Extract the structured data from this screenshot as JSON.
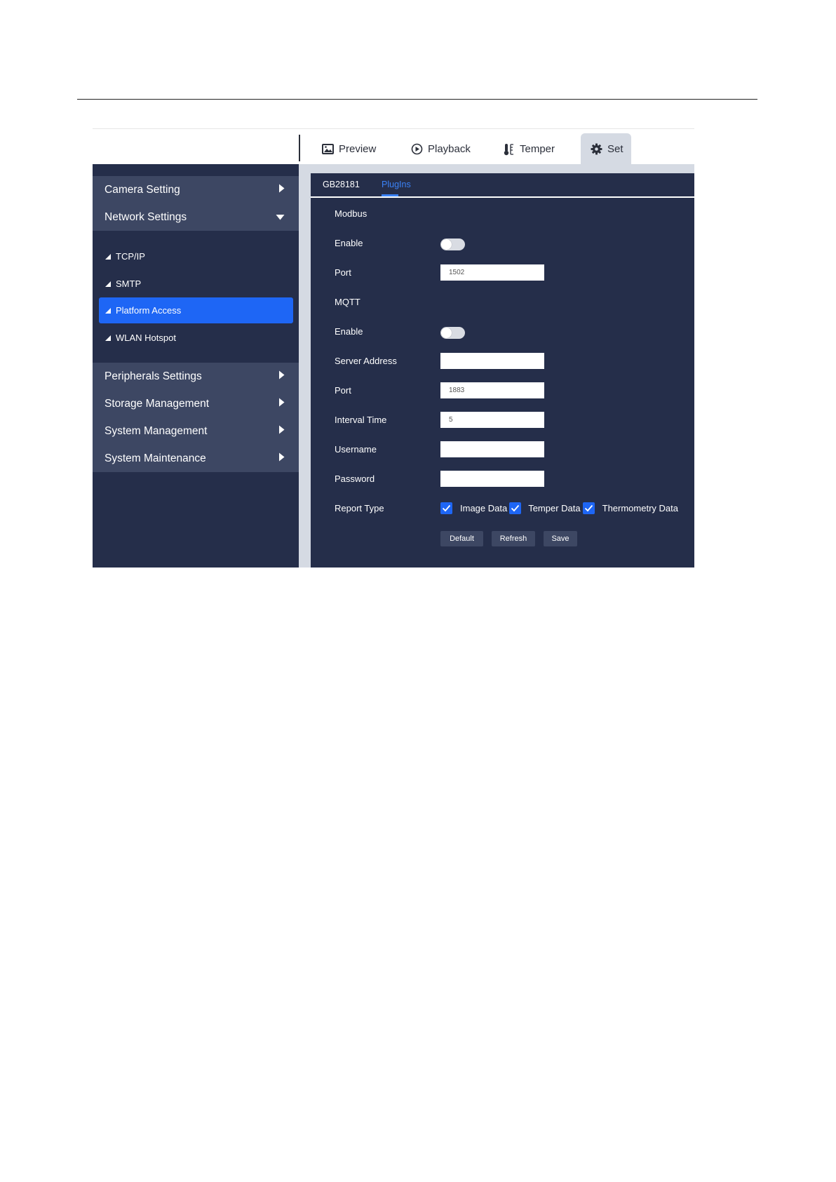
{
  "topnav": {
    "tabs": [
      {
        "label": "Preview",
        "icon": "image-icon"
      },
      {
        "label": "Playback",
        "icon": "play-circle-icon"
      },
      {
        "label": "Temper",
        "icon": "thermometer-icon"
      },
      {
        "label": "Set",
        "icon": "gear-icon",
        "active": true
      }
    ]
  },
  "sidebar": {
    "sections": [
      {
        "label": "Camera Setting",
        "expanded": false
      },
      {
        "label": "Network Settings",
        "expanded": true
      },
      {
        "label": "Peripherals Settings",
        "expanded": false
      },
      {
        "label": "Storage Management",
        "expanded": false
      },
      {
        "label": "System Management",
        "expanded": false
      },
      {
        "label": "System Maintenance",
        "expanded": false
      }
    ],
    "network_items": [
      {
        "label": "TCP/IP"
      },
      {
        "label": "SMTP"
      },
      {
        "label": "Platform Access",
        "active": true
      },
      {
        "label": "WLAN Hotspot"
      }
    ]
  },
  "main": {
    "subtabs": [
      {
        "label": "GB28181"
      },
      {
        "label": "PlugIns",
        "active": true
      }
    ],
    "modbus": {
      "title": "Modbus",
      "enable_label": "Enable",
      "enabled": false,
      "port_label": "Port",
      "port_value": "1502"
    },
    "mqtt": {
      "title": "MQTT",
      "enable_label": "Enable",
      "enabled": false,
      "server_address_label": "Server Address",
      "server_address_value": "",
      "port_label": "Port",
      "port_value": "1883",
      "interval_label": "Interval Time",
      "interval_value": "5",
      "username_label": "Username",
      "username_value": "",
      "password_label": "Password",
      "password_value": "",
      "report_type_label": "Report Type",
      "report_types": [
        {
          "label": "Image Data",
          "checked": true
        },
        {
          "label": "Temper Data",
          "checked": true
        },
        {
          "label": "Thermometry Data",
          "checked": true
        }
      ]
    },
    "buttons": {
      "default": "Default",
      "refresh": "Refresh",
      "save": "Save"
    }
  },
  "colors": {
    "sidebar_bg": "#252e4a",
    "section_header_bg": "#3d4763",
    "accent": "#1e66f5",
    "link_active": "#3b82f6",
    "main_frame_bg": "#d5dae3"
  }
}
